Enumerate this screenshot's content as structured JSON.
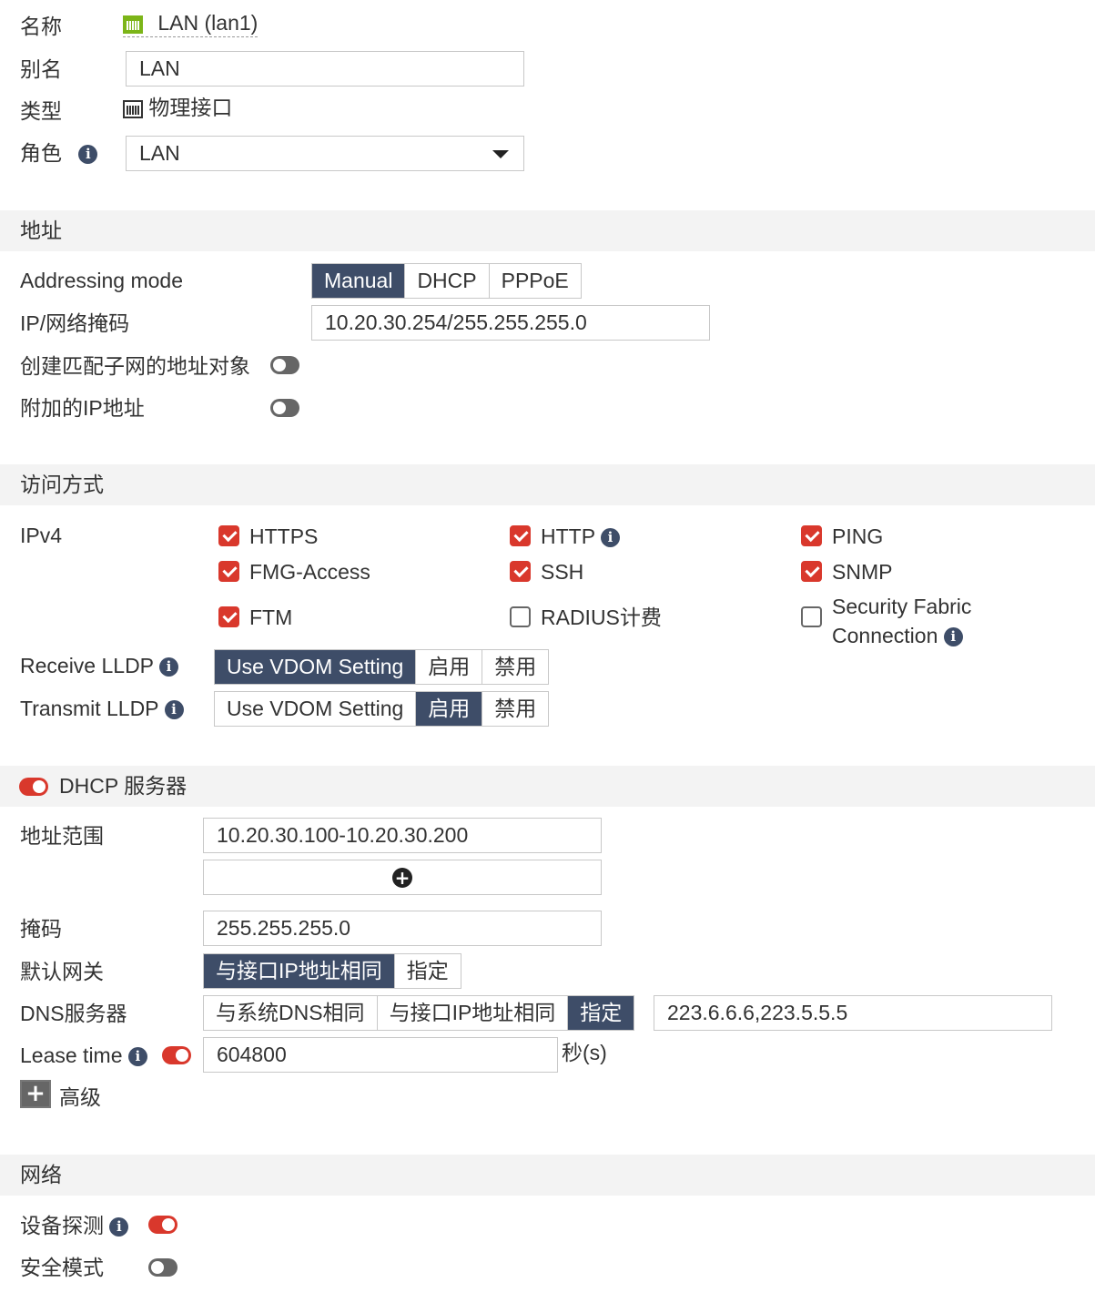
{
  "general": {
    "name_label": "名称",
    "name_value": "LAN (lan1)",
    "alias_label": "别名",
    "alias_value": "LAN",
    "type_label": "类型",
    "type_value": "物理接口",
    "role_label": "角色",
    "role_value": "LAN"
  },
  "address": {
    "header": "地址",
    "mode_label": "Addressing mode",
    "modes": [
      "Manual",
      "DHCP",
      "PPPoE"
    ],
    "mode_selected": "Manual",
    "ip_label": "IP/网络掩码",
    "ip_value": "10.20.30.254/255.255.255.0",
    "create_obj_label": "创建匹配子网的地址对象",
    "create_obj_on": false,
    "secondary_ip_label": "附加的IP地址",
    "secondary_ip_on": false
  },
  "access": {
    "header": "访问方式",
    "ipv4_label": "IPv4",
    "items": [
      {
        "label": "HTTPS",
        "checked": true
      },
      {
        "label": "HTTP",
        "checked": true,
        "info": true
      },
      {
        "label": "PING",
        "checked": true
      },
      {
        "label": "FMG-Access",
        "checked": true
      },
      {
        "label": "SSH",
        "checked": true
      },
      {
        "label": "SNMP",
        "checked": true
      },
      {
        "label": "FTM",
        "checked": true
      },
      {
        "label": "RADIUS计费",
        "checked": false
      },
      {
        "label": "Security Fabric",
        "label2": "Connection",
        "checked": false,
        "info": true
      }
    ],
    "receive_lldp_label": "Receive LLDP",
    "transmit_lldp_label": "Transmit LLDP",
    "lldp_options": [
      "Use VDOM Setting",
      "启用",
      "禁用"
    ],
    "receive_selected": "Use VDOM Setting",
    "transmit_selected": "启用"
  },
  "dhcp": {
    "header": "DHCP 服务器",
    "enabled": true,
    "range_label": "地址范围",
    "range_value": "10.20.30.100-10.20.30.200",
    "mask_label": "掩码",
    "mask_value": "255.255.255.0",
    "gateway_label": "默认网关",
    "gateway_options": [
      "与接口IP地址相同",
      "指定"
    ],
    "gateway_selected": "与接口IP地址相同",
    "dns_label": "DNS服务器",
    "dns_options": [
      "与系统DNS相同",
      "与接口IP地址相同",
      "指定"
    ],
    "dns_selected": "指定",
    "dns_value": "223.6.6.6,223.5.5.5",
    "lease_label": "Lease time",
    "lease_on": true,
    "lease_value": "604800",
    "lease_unit": "秒(s)",
    "advanced_label": "高级"
  },
  "network": {
    "header": "网络",
    "device_detect_label": "设备探测",
    "device_detect_on": true,
    "security_mode_label": "安全模式",
    "security_mode_on": false
  },
  "colors": {
    "accent": "#3e4d68",
    "toggle_on": "#d9382c",
    "section_bg": "#f3f3f3"
  }
}
